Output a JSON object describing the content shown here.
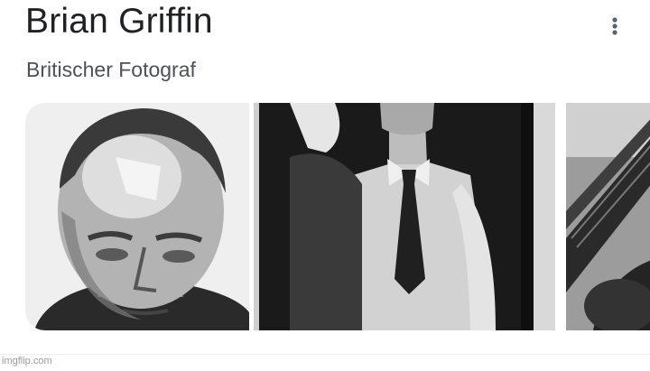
{
  "knowledge_panel": {
    "title": "Brian Griffin",
    "subtitle": "Britischer Fotograf",
    "more_options_icon": "more-vert-icon"
  },
  "images": [
    {
      "name": "portrait-photo",
      "tone": "grayscale"
    },
    {
      "name": "man-in-shirt-and-tie-photo",
      "tone": "grayscale"
    },
    {
      "name": "escalator-photo",
      "tone": "grayscale"
    }
  ],
  "watermark": "imgflip.com",
  "colors": {
    "title": "#202124",
    "subtitle": "#4d5156",
    "icon": "#5f6368",
    "watermark": "#9a9a9a"
  }
}
